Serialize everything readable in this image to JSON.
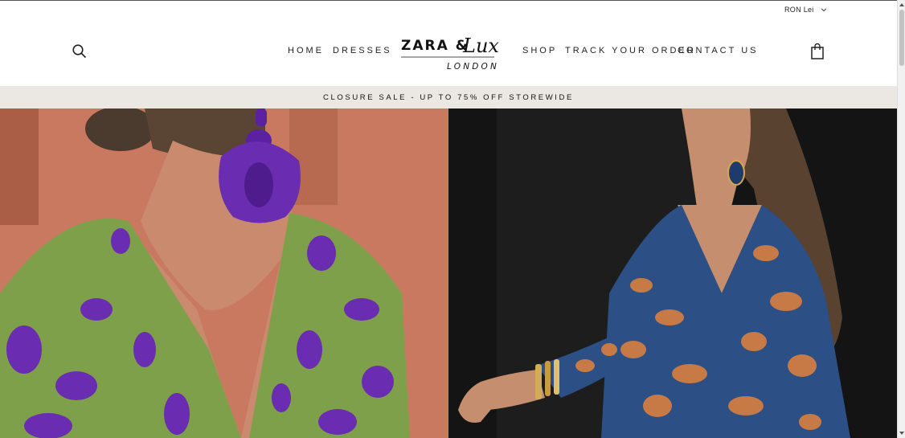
{
  "topbar": {
    "currency_label": "RON Lei"
  },
  "header": {
    "nav_left": [
      "HOME",
      "DRESSES"
    ],
    "nav_right": [
      "SHOP",
      "TRACK YOUR ORDER",
      "CONTACT US"
    ],
    "logo": {
      "brand_top": "ZARA &",
      "brand_script": "Lux",
      "brand_sub": "LONDON"
    }
  },
  "announcement": {
    "text": "CLOSURE SALE - UP TO 75% OFF STOREWIDE"
  },
  "hero": {
    "left_image": "woman-in-green-purple-floral-dress-with-purple-tassel-earring",
    "right_image": "woman-in-blue-orange-paisley-wrap-dress-with-bangles"
  },
  "colors": {
    "announcement_bg": "#ebe8e3",
    "left_bg": "#c9795f",
    "dress_green": "#7fa04a",
    "accent_purple": "#6a2cb0",
    "right_bg": "#141414",
    "dress_blue": "#2c4f86",
    "paisley_orange": "#c77a45"
  },
  "icons": {
    "search": "search-icon",
    "cart": "shopping-bag-icon",
    "currency_toggle": "chevron-down-icon"
  }
}
